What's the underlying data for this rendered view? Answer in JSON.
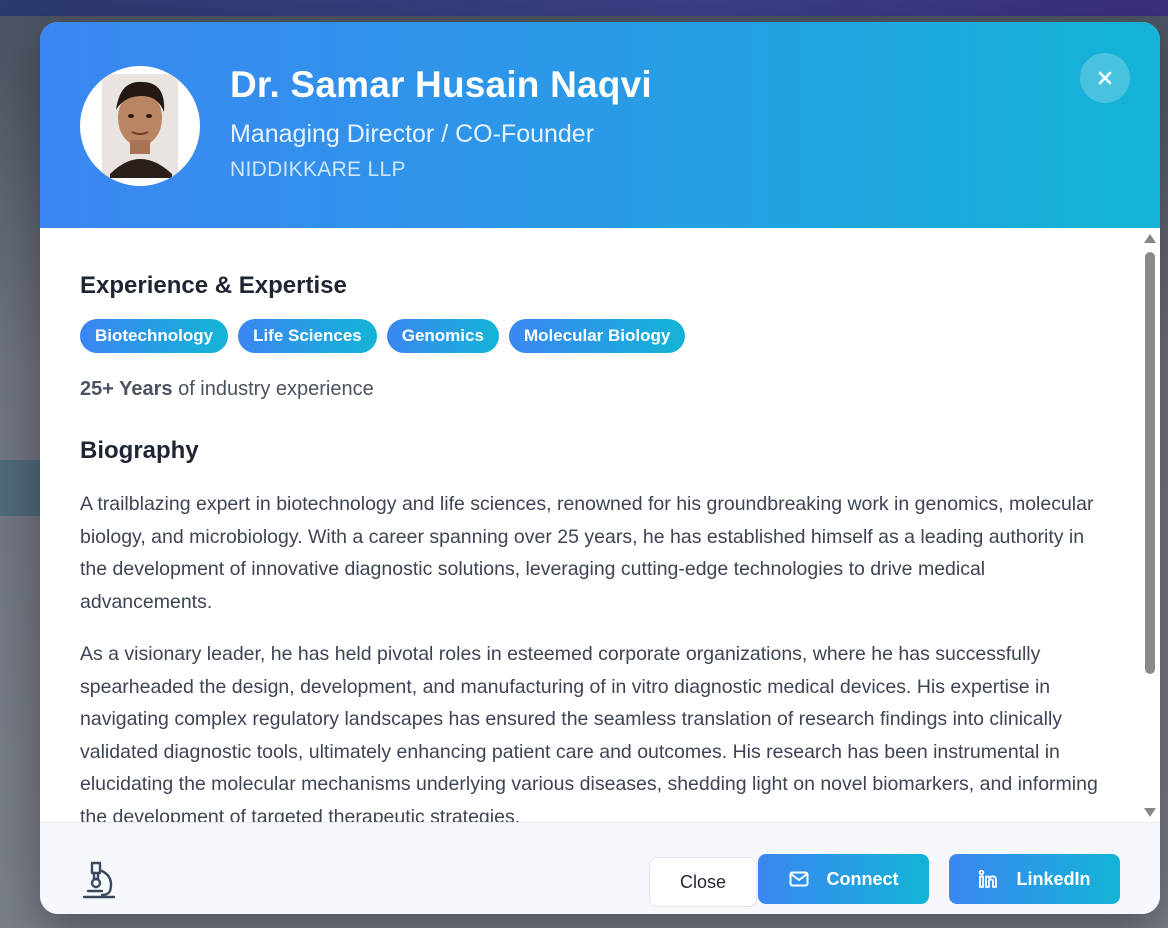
{
  "profile": {
    "name": "Dr. Samar Husain Naqvi",
    "role": "Managing Director / CO-Founder",
    "company": "NIDDIKKARE LLP",
    "avatar_icon": "person-portrait"
  },
  "experience_section": {
    "title": "Experience & Expertise",
    "tags": [
      "Biotechnology",
      "Life Sciences",
      "Genomics",
      "Molecular Biology"
    ],
    "years": "25+ Years",
    "years_suffix": " of industry experience"
  },
  "biography_section": {
    "title": "Biography",
    "paragraphs": [
      "A trailblazing expert in biotechnology and life sciences, renowned for his groundbreaking work in genomics, molecular biology, and microbiology. With a career spanning over 25 years, he has established himself as a leading authority in the development of innovative diagnostic solutions, leveraging cutting-edge technologies to drive medical advancements.",
      "As a visionary leader, he has held pivotal roles in esteemed corporate organizations, where he has successfully spearheaded the design, development, and manufacturing of in vitro diagnostic medical devices. His expertise in navigating complex regulatory landscapes has ensured the seamless translation of research findings into clinically validated diagnostic tools, ultimately enhancing patient care and outcomes. His research has been instrumental in elucidating the molecular mechanisms underlying various diseases, shedding light on novel biomarkers, and informing the development of targeted therapeutic strategies."
    ]
  },
  "footer": {
    "icon": "microscope-icon",
    "close_label": "Close",
    "connect_label": "Connect",
    "linkedin_label": "LinkedIn"
  },
  "colors": {
    "gradient_start": "#3b86f2",
    "gradient_end": "#13b4d6"
  }
}
